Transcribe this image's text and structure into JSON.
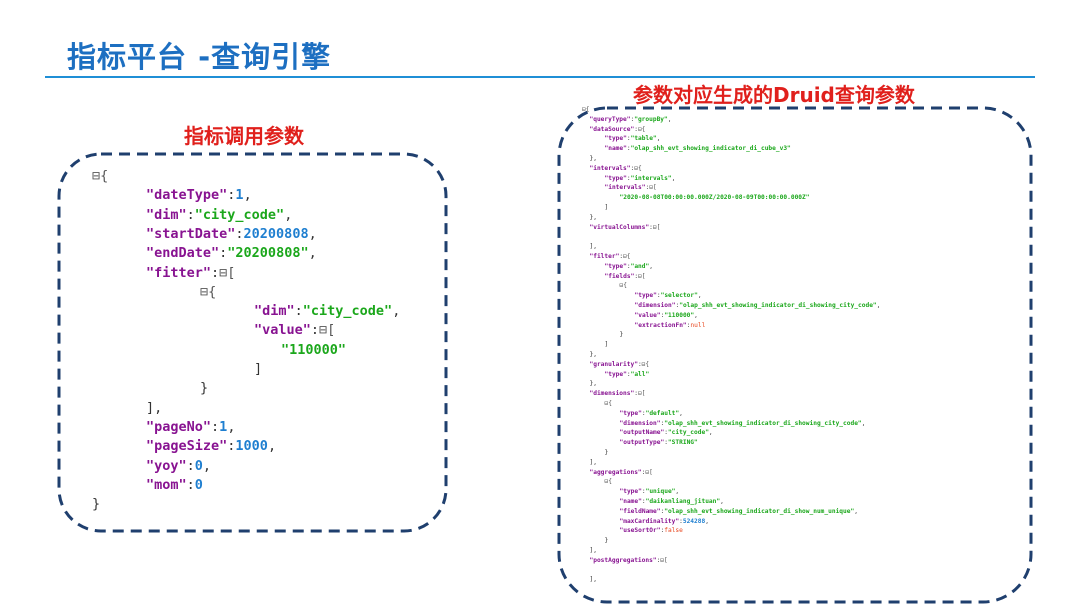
{
  "slide": {
    "title": "指标平台 -查询引擎",
    "left_heading": "指标调用参数",
    "right_heading": "参数对应生成的Druid查询参数"
  },
  "colors": {
    "title": "#1d6fc1",
    "rule": "#1f8fd6",
    "heading": "#e0201c",
    "frame_dash": "#1f3f6e",
    "json_key": "#881391",
    "json_string": "#1ba71b",
    "json_number": "#1f7fd0",
    "json_boolean": "#e8461e"
  },
  "left_code": [
    {
      "i": 0,
      "segs": [
        [
          "t",
          "⊟{"
        ]
      ]
    },
    {
      "i": 2,
      "segs": [
        [
          "k",
          "\"dateType\""
        ],
        [
          "p",
          ":"
        ],
        [
          "n",
          "1"
        ],
        [
          "p",
          ","
        ]
      ]
    },
    {
      "i": 2,
      "segs": [
        [
          "k",
          "\"dim\""
        ],
        [
          "p",
          ":"
        ],
        [
          "s",
          "\"city_code\""
        ],
        [
          "p",
          ","
        ]
      ]
    },
    {
      "i": 2,
      "segs": [
        [
          "k",
          "\"startDate\""
        ],
        [
          "p",
          ":"
        ],
        [
          "n",
          "20200808"
        ],
        [
          "p",
          ","
        ]
      ]
    },
    {
      "i": 2,
      "segs": [
        [
          "k",
          "\"endDate\""
        ],
        [
          "p",
          ":"
        ],
        [
          "s",
          "\"20200808\""
        ],
        [
          "p",
          ","
        ]
      ]
    },
    {
      "i": 2,
      "segs": [
        [
          "k",
          "\"fitter\""
        ],
        [
          "p",
          ":"
        ],
        [
          "t",
          "⊟["
        ]
      ]
    },
    {
      "i": 4,
      "segs": [
        [
          "t",
          "⊟{"
        ]
      ]
    },
    {
      "i": 6,
      "segs": [
        [
          "k",
          "\"dim\""
        ],
        [
          "p",
          ":"
        ],
        [
          "s",
          "\"city_code\""
        ],
        [
          "p",
          ","
        ]
      ]
    },
    {
      "i": 6,
      "segs": [
        [
          "k",
          "\"value\""
        ],
        [
          "p",
          ":"
        ],
        [
          "t",
          "⊟["
        ]
      ]
    },
    {
      "i": 7,
      "segs": [
        [
          "s",
          "\"110000\""
        ]
      ]
    },
    {
      "i": 6,
      "segs": [
        [
          "p",
          "]"
        ]
      ]
    },
    {
      "i": 4,
      "segs": [
        [
          "p",
          "}"
        ]
      ]
    },
    {
      "i": 2,
      "segs": [
        [
          "p",
          "],"
        ]
      ]
    },
    {
      "i": 2,
      "segs": [
        [
          "k",
          "\"pageNo\""
        ],
        [
          "p",
          ":"
        ],
        [
          "n",
          "1"
        ],
        [
          "p",
          ","
        ]
      ]
    },
    {
      "i": 2,
      "segs": [
        [
          "k",
          "\"pageSize\""
        ],
        [
          "p",
          ":"
        ],
        [
          "n",
          "1000"
        ],
        [
          "p",
          ","
        ]
      ]
    },
    {
      "i": 2,
      "segs": [
        [
          "k",
          "\"yoy\""
        ],
        [
          "p",
          ":"
        ],
        [
          "n",
          "0"
        ],
        [
          "p",
          ","
        ]
      ]
    },
    {
      "i": 2,
      "segs": [
        [
          "k",
          "\"mom\""
        ],
        [
          "p",
          ":"
        ],
        [
          "n",
          "0"
        ]
      ]
    },
    {
      "i": 0,
      "segs": [
        [
          "p",
          "}"
        ]
      ]
    }
  ],
  "right_code": [
    {
      "i": 0,
      "segs": [
        [
          "t",
          "⊟{"
        ]
      ]
    },
    {
      "i": 1,
      "segs": [
        [
          "k",
          "\"queryType\""
        ],
        [
          "p",
          ":"
        ],
        [
          "s",
          "\"groupBy\""
        ],
        [
          "p",
          ","
        ]
      ]
    },
    {
      "i": 1,
      "segs": [
        [
          "k",
          "\"dataSource\""
        ],
        [
          "p",
          ":"
        ],
        [
          "t",
          "⊟{"
        ]
      ]
    },
    {
      "i": 3,
      "segs": [
        [
          "k",
          "\"type\""
        ],
        [
          "p",
          ":"
        ],
        [
          "s",
          "\"table\""
        ],
        [
          "p",
          ","
        ]
      ]
    },
    {
      "i": 3,
      "segs": [
        [
          "k",
          "\"name\""
        ],
        [
          "p",
          ":"
        ],
        [
          "s",
          "\"olap_shh_evt_showing_indicator_di_cube_v3\""
        ]
      ]
    },
    {
      "i": 1,
      "segs": [
        [
          "p",
          "},"
        ]
      ]
    },
    {
      "i": 1,
      "segs": [
        [
          "k",
          "\"intervals\""
        ],
        [
          "p",
          ":"
        ],
        [
          "t",
          "⊟{"
        ]
      ]
    },
    {
      "i": 3,
      "segs": [
        [
          "k",
          "\"type\""
        ],
        [
          "p",
          ":"
        ],
        [
          "s",
          "\"intervals\""
        ],
        [
          "p",
          ","
        ]
      ]
    },
    {
      "i": 3,
      "segs": [
        [
          "k",
          "\"intervals\""
        ],
        [
          "p",
          ":"
        ],
        [
          "t",
          "⊟["
        ]
      ]
    },
    {
      "i": 5,
      "segs": [
        [
          "s",
          "\"2020-08-08T00:00:00.000Z/2020-08-09T00:00:00.000Z\""
        ]
      ]
    },
    {
      "i": 3,
      "segs": [
        [
          "p",
          "]"
        ]
      ]
    },
    {
      "i": 1,
      "segs": [
        [
          "p",
          "},"
        ]
      ]
    },
    {
      "i": 1,
      "segs": [
        [
          "k",
          "\"virtualColumns\""
        ],
        [
          "p",
          ":"
        ],
        [
          "t",
          "⊟["
        ]
      ]
    },
    {
      "i": 1,
      "segs": []
    },
    {
      "i": 1,
      "segs": [
        [
          "p",
          "],"
        ]
      ]
    },
    {
      "i": 1,
      "segs": [
        [
          "k",
          "\"filter\""
        ],
        [
          "p",
          ":"
        ],
        [
          "t",
          "⊟{"
        ]
      ]
    },
    {
      "i": 3,
      "segs": [
        [
          "k",
          "\"type\""
        ],
        [
          "p",
          ":"
        ],
        [
          "s",
          "\"and\""
        ],
        [
          "p",
          ","
        ]
      ]
    },
    {
      "i": 3,
      "segs": [
        [
          "k",
          "\"fields\""
        ],
        [
          "p",
          ":"
        ],
        [
          "t",
          "⊟["
        ]
      ]
    },
    {
      "i": 5,
      "segs": [
        [
          "t",
          "⊟{"
        ]
      ]
    },
    {
      "i": 7,
      "segs": [
        [
          "k",
          "\"type\""
        ],
        [
          "p",
          ":"
        ],
        [
          "s",
          "\"selector\""
        ],
        [
          "p",
          ","
        ]
      ]
    },
    {
      "i": 7,
      "segs": [
        [
          "k",
          "\"dimension\""
        ],
        [
          "p",
          ":"
        ],
        [
          "s",
          "\"olap_shh_evt_showing_indicator_di_showing_city_code\""
        ],
        [
          "p",
          ","
        ]
      ]
    },
    {
      "i": 7,
      "segs": [
        [
          "k",
          "\"value\""
        ],
        [
          "p",
          ":"
        ],
        [
          "s",
          "\"110000\""
        ],
        [
          "p",
          ","
        ]
      ]
    },
    {
      "i": 7,
      "segs": [
        [
          "k",
          "\"extractionFn\""
        ],
        [
          "p",
          ":"
        ],
        [
          "b",
          "null"
        ]
      ]
    },
    {
      "i": 5,
      "segs": [
        [
          "p",
          "}"
        ]
      ]
    },
    {
      "i": 3,
      "segs": [
        [
          "p",
          "]"
        ]
      ]
    },
    {
      "i": 1,
      "segs": [
        [
          "p",
          "},"
        ]
      ]
    },
    {
      "i": 1,
      "segs": [
        [
          "k",
          "\"granularity\""
        ],
        [
          "p",
          ":"
        ],
        [
          "t",
          "⊟{"
        ]
      ]
    },
    {
      "i": 3,
      "segs": [
        [
          "k",
          "\"type\""
        ],
        [
          "p",
          ":"
        ],
        [
          "s",
          "\"all\""
        ]
      ]
    },
    {
      "i": 1,
      "segs": [
        [
          "p",
          "},"
        ]
      ]
    },
    {
      "i": 1,
      "segs": [
        [
          "k",
          "\"dimensions\""
        ],
        [
          "p",
          ":"
        ],
        [
          "t",
          "⊟["
        ]
      ]
    },
    {
      "i": 3,
      "segs": [
        [
          "t",
          "⊟{"
        ]
      ]
    },
    {
      "i": 5,
      "segs": [
        [
          "k",
          "\"type\""
        ],
        [
          "p",
          ":"
        ],
        [
          "s",
          "\"default\""
        ],
        [
          "p",
          ","
        ]
      ]
    },
    {
      "i": 5,
      "segs": [
        [
          "k",
          "\"dimension\""
        ],
        [
          "p",
          ":"
        ],
        [
          "s",
          "\"olap_shh_evt_showing_indicator_di_showing_city_code\""
        ],
        [
          "p",
          ","
        ]
      ]
    },
    {
      "i": 5,
      "segs": [
        [
          "k",
          "\"outputName\""
        ],
        [
          "p",
          ":"
        ],
        [
          "s",
          "\"city_code\""
        ],
        [
          "p",
          ","
        ]
      ]
    },
    {
      "i": 5,
      "segs": [
        [
          "k",
          "\"outputType\""
        ],
        [
          "p",
          ":"
        ],
        [
          "s",
          "\"STRING\""
        ]
      ]
    },
    {
      "i": 3,
      "segs": [
        [
          "p",
          "}"
        ]
      ]
    },
    {
      "i": 1,
      "segs": [
        [
          "p",
          "],"
        ]
      ]
    },
    {
      "i": 1,
      "segs": [
        [
          "k",
          "\"aggregations\""
        ],
        [
          "p",
          ":"
        ],
        [
          "t",
          "⊟["
        ]
      ]
    },
    {
      "i": 3,
      "segs": [
        [
          "t",
          "⊟{"
        ]
      ]
    },
    {
      "i": 5,
      "segs": [
        [
          "k",
          "\"type\""
        ],
        [
          "p",
          ":"
        ],
        [
          "s",
          "\"unique\""
        ],
        [
          "p",
          ","
        ]
      ]
    },
    {
      "i": 5,
      "segs": [
        [
          "k",
          "\"name\""
        ],
        [
          "p",
          ":"
        ],
        [
          "s",
          "\"daikanliang_jituan\""
        ],
        [
          "p",
          ","
        ]
      ]
    },
    {
      "i": 5,
      "segs": [
        [
          "k",
          "\"fieldName\""
        ],
        [
          "p",
          ":"
        ],
        [
          "s",
          "\"olap_shh_evt_showing_indicator_di_show_num_unique\""
        ],
        [
          "p",
          ","
        ]
      ]
    },
    {
      "i": 5,
      "segs": [
        [
          "k",
          "\"maxCardinality\""
        ],
        [
          "p",
          ":"
        ],
        [
          "n",
          "524288"
        ],
        [
          "p",
          ","
        ]
      ]
    },
    {
      "i": 5,
      "segs": [
        [
          "k",
          "\"useSortOr\""
        ],
        [
          "p",
          ":"
        ],
        [
          "b",
          "false"
        ]
      ]
    },
    {
      "i": 3,
      "segs": [
        [
          "p",
          "}"
        ]
      ]
    },
    {
      "i": 1,
      "segs": [
        [
          "p",
          "],"
        ]
      ]
    },
    {
      "i": 1,
      "segs": [
        [
          "k",
          "\"postAggregations\""
        ],
        [
          "p",
          ":"
        ],
        [
          "t",
          "⊟["
        ]
      ]
    },
    {
      "i": 1,
      "segs": []
    },
    {
      "i": 1,
      "segs": [
        [
          "p",
          "],"
        ]
      ]
    }
  ]
}
